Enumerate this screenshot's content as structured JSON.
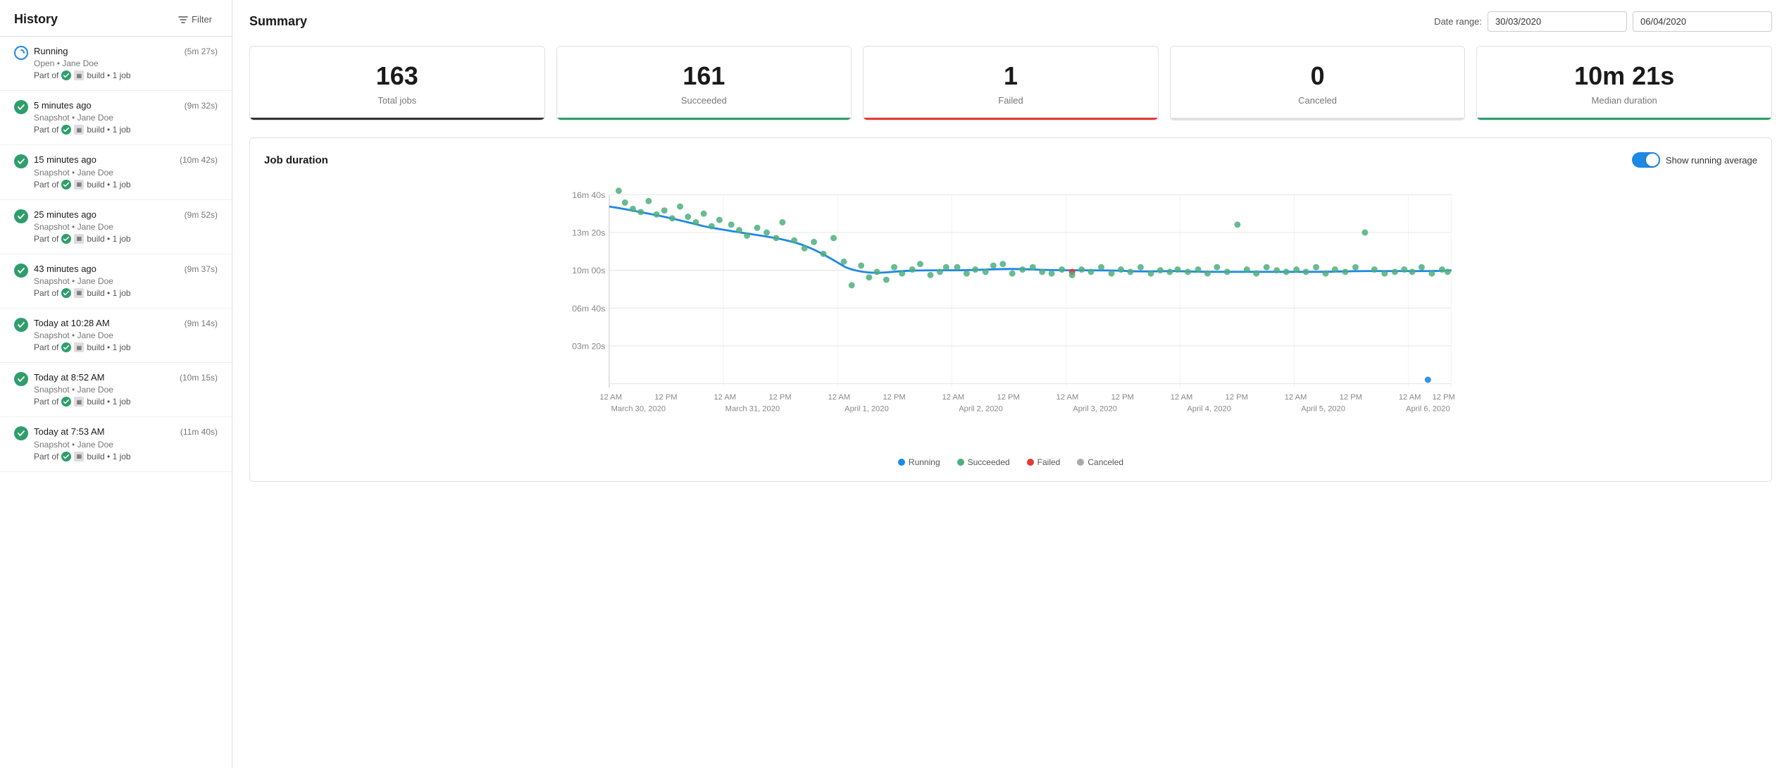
{
  "sidebar": {
    "title": "History",
    "filter_label": "Filter",
    "items": [
      {
        "id": 1,
        "status": "running",
        "title": "Running",
        "sub": "Open • Jane Doe",
        "meta": "Part of",
        "build_label": "build • 1 job",
        "duration": "(5m 27s)"
      },
      {
        "id": 2,
        "status": "success",
        "title": "5 minutes ago",
        "sub": "Snapshot • Jane Doe",
        "meta": "Part of",
        "build_label": "build • 1 job",
        "duration": "(9m 32s)"
      },
      {
        "id": 3,
        "status": "success",
        "title": "15 minutes ago",
        "sub": "Snapshot • Jane Doe",
        "meta": "Part of",
        "build_label": "build • 1 job",
        "duration": "(10m 42s)"
      },
      {
        "id": 4,
        "status": "success",
        "title": "25 minutes ago",
        "sub": "Snapshot • Jane Doe",
        "meta": "Part of",
        "build_label": "build • 1 job",
        "duration": "(9m 52s)"
      },
      {
        "id": 5,
        "status": "success",
        "title": "43 minutes ago",
        "sub": "Snapshot • Jane Doe",
        "meta": "Part of",
        "build_label": "build • 1 job",
        "duration": "(9m 37s)"
      },
      {
        "id": 6,
        "status": "success",
        "title": "Today at 10:28 AM",
        "sub": "Snapshot • Jane Doe",
        "meta": "Part of",
        "build_label": "build • 1 job",
        "duration": "(9m 14s)"
      },
      {
        "id": 7,
        "status": "success",
        "title": "Today at 8:52 AM",
        "sub": "Snapshot • Jane Doe",
        "meta": "Part of",
        "build_label": "build • 1 job",
        "duration": "(10m 15s)"
      },
      {
        "id": 8,
        "status": "success",
        "title": "Today at 7:53 AM",
        "sub": "Snapshot • Jane Doe",
        "meta": "Part of",
        "build_label": "build • 1 job",
        "duration": "(11m 40s)"
      }
    ]
  },
  "main": {
    "title": "Summary",
    "date_range_label": "Date range:",
    "date_from": "30/03/2020",
    "date_to": "06/04/2020",
    "stats": [
      {
        "id": "total",
        "value": "163",
        "label": "Total jobs",
        "type": "total"
      },
      {
        "id": "succeeded",
        "value": "161",
        "label": "Succeeded",
        "type": "succeeded"
      },
      {
        "id": "failed",
        "value": "1",
        "label": "Failed",
        "type": "failed"
      },
      {
        "id": "canceled",
        "value": "0",
        "label": "Canceled",
        "type": "canceled"
      },
      {
        "id": "duration",
        "value": "10m 21s",
        "label": "Median duration",
        "type": "duration"
      }
    ],
    "chart": {
      "title": "Job duration",
      "toggle_label": "Show running average",
      "y_labels": [
        "16m 40s",
        "13m 20s",
        "10m 00s",
        "06m 40s",
        "03m 20s"
      ],
      "x_labels": [
        {
          "time": "12 AM",
          "date": "March 30, 2020"
        },
        {
          "time": "12 PM",
          "date": ""
        },
        {
          "time": "12 AM",
          "date": "March 31, 2020"
        },
        {
          "time": "12 PM",
          "date": ""
        },
        {
          "time": "12 AM",
          "date": "April 1, 2020"
        },
        {
          "time": "12 PM",
          "date": ""
        },
        {
          "time": "12 AM",
          "date": "April 2, 2020"
        },
        {
          "time": "12 PM",
          "date": ""
        },
        {
          "time": "12 AM",
          "date": "April 3, 2020"
        },
        {
          "time": "12 PM",
          "date": ""
        },
        {
          "time": "12 AM",
          "date": "April 4, 2020"
        },
        {
          "time": "12 PM",
          "date": ""
        },
        {
          "time": "12 AM",
          "date": "April 5, 2020"
        },
        {
          "time": "12 PM",
          "date": ""
        },
        {
          "time": "12 AM",
          "date": "April 6, 2020"
        },
        {
          "time": "12 PM",
          "date": ""
        }
      ],
      "legend": [
        {
          "color": "#1e88e5",
          "label": "Running"
        },
        {
          "color": "#4caf7d",
          "label": "Succeeded"
        },
        {
          "color": "#e53935",
          "label": "Failed"
        },
        {
          "color": "#aaa",
          "label": "Canceled"
        }
      ]
    }
  }
}
